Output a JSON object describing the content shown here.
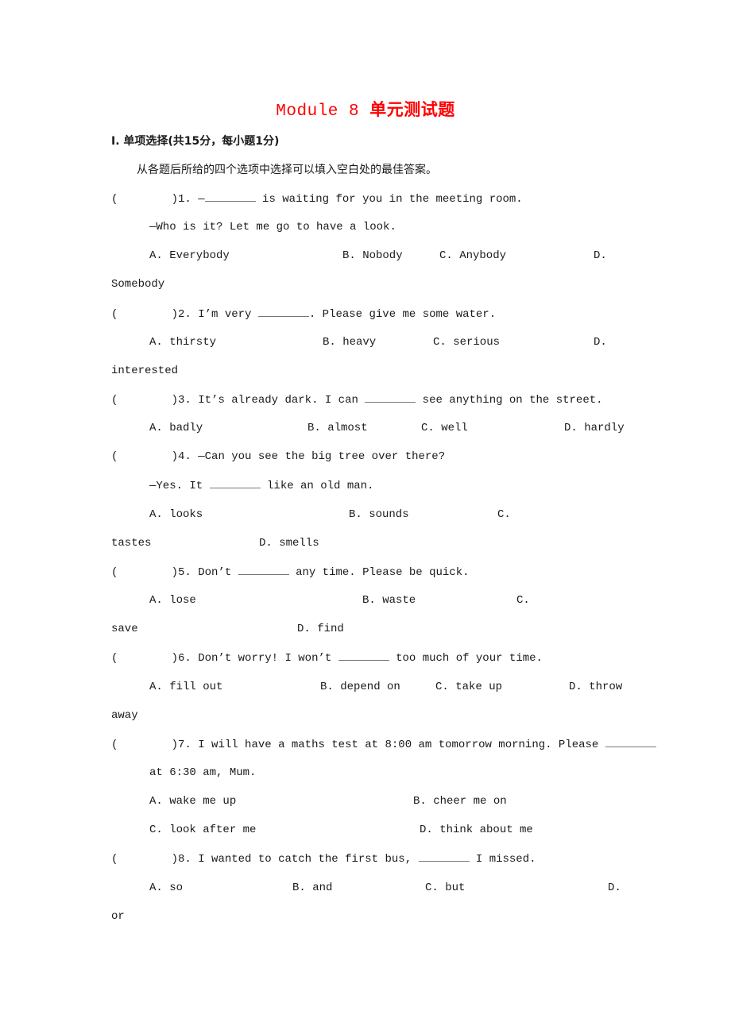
{
  "document": {
    "title_latin": "Module 8 ",
    "title_cjk": "单元测试题",
    "title_color": "#ff0000",
    "section": {
      "heading": "Ⅰ. 单项选择(共15分，每小题1分)",
      "instruction": "从各题后所给的四个选项中选择可以填入空白处的最佳答案。"
    },
    "questions": [
      {
        "number": "1.",
        "stem_before": "—",
        "stem_after": " is waiting for you in the meeting room.",
        "line2": "—Who is it? Let me go to have a look.",
        "options": [
          "A. Everybody",
          "B. Nobody",
          "C. Anybody",
          "D."
        ],
        "wrap": "Somebody"
      },
      {
        "number": "2.",
        "stem_before": "I’m very ",
        "stem_after": ". Please give me some water.",
        "options": [
          "A. thirsty",
          "B. heavy",
          "C. serious",
          "D."
        ],
        "wrap": "interested"
      },
      {
        "number": "3.",
        "stem_before": " It’s already dark. I can ",
        "stem_after": " see anything on the street.",
        "options": [
          "A. badly",
          "B. almost",
          "C. well",
          "D. hardly"
        ]
      },
      {
        "number": "4.",
        "stem_before": " —Can you see the big tree over there?",
        "line2_before": "—Yes. It ",
        "line2_after": " like an old man.",
        "options": [
          "A. looks",
          "B. sounds",
          "C."
        ],
        "wrap": "tastes",
        "wrap_option": "D. smells"
      },
      {
        "number": "5.",
        "stem_before": "Don’t ",
        "stem_after": " any time. Please be quick.",
        "options": [
          "A. lose",
          "B. waste",
          "C."
        ],
        "wrap": "save",
        "wrap_option": "D. find"
      },
      {
        "number": "6.",
        "stem_before": "Don’t worry! I won’t ",
        "stem_after": " too much of your time.",
        "options": [
          "A. fill out",
          "B. depend on",
          "C. take up",
          "D. throw"
        ],
        "wrap": "away"
      },
      {
        "number": "7.",
        "stem_before": "I will have a maths test at 8:00 am tomorrow morning. Please ",
        "line2": "at 6:30 am, Mum.",
        "options": [
          "A. wake me up",
          "B. cheer me on",
          "C. look after me",
          "D. think about me"
        ]
      },
      {
        "number": "8.",
        "stem_before": "I wanted to catch the first bus, ",
        "stem_after": " I missed.",
        "options": [
          "A. so",
          "B. and",
          "C. but",
          "D."
        ],
        "wrap": "or"
      }
    ],
    "answer_paren_open": "(",
    "answer_paren_close": ")"
  }
}
